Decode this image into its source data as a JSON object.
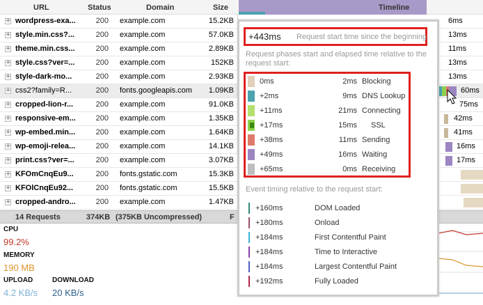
{
  "columns": {
    "url": "URL",
    "status": "Status",
    "domain": "Domain",
    "size": "Size",
    "timeline": "Timeline"
  },
  "rows": [
    {
      "url": "wordpress-exa...",
      "status": "200",
      "domain": "example.com",
      "size": "15.2KB",
      "time": "6ms"
    },
    {
      "url": "style.min.css?...",
      "status": "200",
      "domain": "example.com",
      "size": "57.0KB",
      "time": "13ms"
    },
    {
      "url": "theme.min.css...",
      "status": "200",
      "domain": "example.com",
      "size": "2.89KB",
      "time": "11ms"
    },
    {
      "url": "style.css?ver=...",
      "status": "200",
      "domain": "example.com",
      "size": "152KB",
      "time": "13ms"
    },
    {
      "url": "style-dark-mo...",
      "status": "200",
      "domain": "example.com",
      "size": "2.93KB",
      "time": "13ms"
    },
    {
      "url": "css2?family=R...",
      "status": "200",
      "domain": "fonts.googleapis.com",
      "size": "1.09KB",
      "time": "60ms"
    },
    {
      "url": "cropped-lion-r...",
      "status": "200",
      "domain": "example.com",
      "size": "91.0KB",
      "time": "75ms"
    },
    {
      "url": "responsive-em...",
      "status": "200",
      "domain": "example.com",
      "size": "1.35KB",
      "time": "42ms"
    },
    {
      "url": "wp-embed.min...",
      "status": "200",
      "domain": "example.com",
      "size": "1.64KB",
      "time": "41ms"
    },
    {
      "url": "wp-emoji-relea...",
      "status": "200",
      "domain": "example.com",
      "size": "14.1KB",
      "time": "16ms"
    },
    {
      "url": "print.css?ver=...",
      "status": "200",
      "domain": "example.com",
      "size": "3.07KB",
      "time": "17ms"
    },
    {
      "url": "KFOmCnqEu9...",
      "status": "200",
      "domain": "fonts.gstatic.com",
      "size": "15.3KB",
      "time": ""
    },
    {
      "url": "KFOlCnqEu92...",
      "status": "200",
      "domain": "fonts.gstatic.com",
      "size": "15.5KB",
      "time": ""
    },
    {
      "url": "cropped-andro...",
      "status": "200",
      "domain": "example.com",
      "size": "1.47KB",
      "time": ""
    }
  ],
  "summary": {
    "requests": "14 Requests",
    "size": "374KB",
    "uncompressed": "(375KB Uncompressed)",
    "extra": "F"
  },
  "perf": {
    "cpu_label": "CPU",
    "cpu_value": "99.2%",
    "memory_label": "MEMORY",
    "memory_value": "190 MB",
    "upload_label": "UPLOAD",
    "upload_value": "4.2 KB/s",
    "download_label": "DOWNLOAD",
    "download_value": "20 KB/s",
    "colors": {
      "cpu": "#c0392b",
      "memory": "#d9962b",
      "upload": "#7fb3d5",
      "download": "#2c5f8a"
    }
  },
  "tooltip": {
    "start_value": "+443ms",
    "start_desc": "Request start time since the beginning",
    "phases_caption_1": "Request phases start and elapsed time relative to the",
    "phases_caption_2": "request start:",
    "phases": [
      {
        "start": "0ms",
        "elapsed": "2ms",
        "name": "Blocking",
        "color": "#e0d0b8"
      },
      {
        "start": "+2ms",
        "elapsed": "9ms",
        "name": "DNS Lookup",
        "color": "#4aa3ae"
      },
      {
        "start": "+11ms",
        "elapsed": "21ms",
        "name": "Connecting",
        "color": "#b5e06e"
      },
      {
        "start": "+17ms",
        "elapsed": "15ms",
        "name": "SSL",
        "color": "#8fd14f"
      },
      {
        "start": "+38ms",
        "elapsed": "11ms",
        "name": "Sending",
        "color": "#e07a6a"
      },
      {
        "start": "+49ms",
        "elapsed": "16ms",
        "name": "Waiting",
        "color": "#9b86c2"
      },
      {
        "start": "+65ms",
        "elapsed": "0ms",
        "name": "Receiving",
        "color": "#bdbdbd"
      }
    ],
    "events_caption": "Event timing relative to the request start:",
    "events": [
      {
        "time": "+160ms",
        "name": "DOM Loaded",
        "color": "#2e8b7a"
      },
      {
        "time": "+180ms",
        "name": "Onload",
        "color": "#9b4f6e"
      },
      {
        "time": "+184ms",
        "name": "First Contentful Paint",
        "color": "#3bb3d9"
      },
      {
        "time": "+184ms",
        "name": "Time to Interactive",
        "color": "#8b3fa8"
      },
      {
        "time": "+184ms",
        "name": "Largest Contentful Paint",
        "color": "#4a5fc1"
      },
      {
        "time": "+192ms",
        "name": "Fully Loaded",
        "color": "#b0284a"
      }
    ]
  }
}
